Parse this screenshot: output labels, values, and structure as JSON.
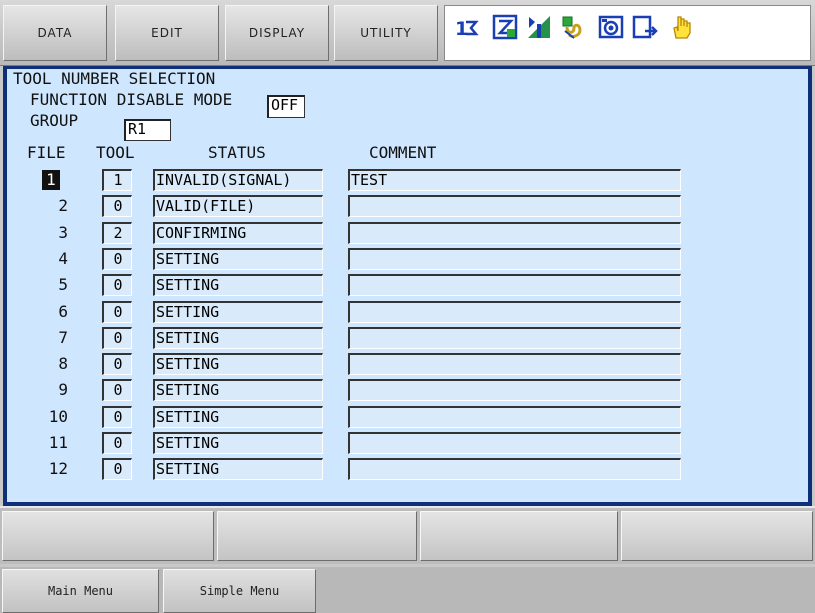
{
  "menu": [
    "DATA",
    "EDIT",
    "DISPLAY",
    "UTILITY"
  ],
  "status_icons": [
    "sync-icon",
    "edit-mode-icon",
    "signal-icon",
    "link-icon",
    "camera-icon",
    "arrow-doc-icon",
    "hand-icon"
  ],
  "screen": {
    "title": "TOOL NUMBER SELECTION",
    "function_disable_label": "FUNCTION DISABLE MODE",
    "function_disable_value": "OFF",
    "group_label": "GROUP",
    "group_value": "R1",
    "headers": {
      "file": "FILE",
      "tool": "TOOL",
      "status": "STATUS",
      "comment": "COMMENT"
    },
    "rows": [
      {
        "file": "1",
        "tool": "1",
        "status": "INVALID(SIGNAL)",
        "comment": "TEST"
      },
      {
        "file": "2",
        "tool": "0",
        "status": "VALID(FILE)",
        "comment": ""
      },
      {
        "file": "3",
        "tool": "2",
        "status": "CONFIRMING",
        "comment": ""
      },
      {
        "file": "4",
        "tool": "0",
        "status": "SETTING",
        "comment": ""
      },
      {
        "file": "5",
        "tool": "0",
        "status": "SETTING",
        "comment": ""
      },
      {
        "file": "6",
        "tool": "0",
        "status": "SETTING",
        "comment": ""
      },
      {
        "file": "7",
        "tool": "0",
        "status": "SETTING",
        "comment": ""
      },
      {
        "file": "8",
        "tool": "0",
        "status": "SETTING",
        "comment": ""
      },
      {
        "file": "9",
        "tool": "0",
        "status": "SETTING",
        "comment": ""
      },
      {
        "file": "10",
        "tool": "0",
        "status": "SETTING",
        "comment": ""
      },
      {
        "file": "11",
        "tool": "0",
        "status": "SETTING",
        "comment": ""
      },
      {
        "file": "12",
        "tool": "0",
        "status": "SETTING",
        "comment": ""
      }
    ]
  },
  "bottom": {
    "main_menu": "Main Menu",
    "simple_menu": "Simple Menu"
  },
  "colors": {
    "panel_bg": "#cfe6ff",
    "panel_border": "#0f2f7a",
    "cell_bg": "#d9ebfb",
    "cursor": "#111111"
  }
}
